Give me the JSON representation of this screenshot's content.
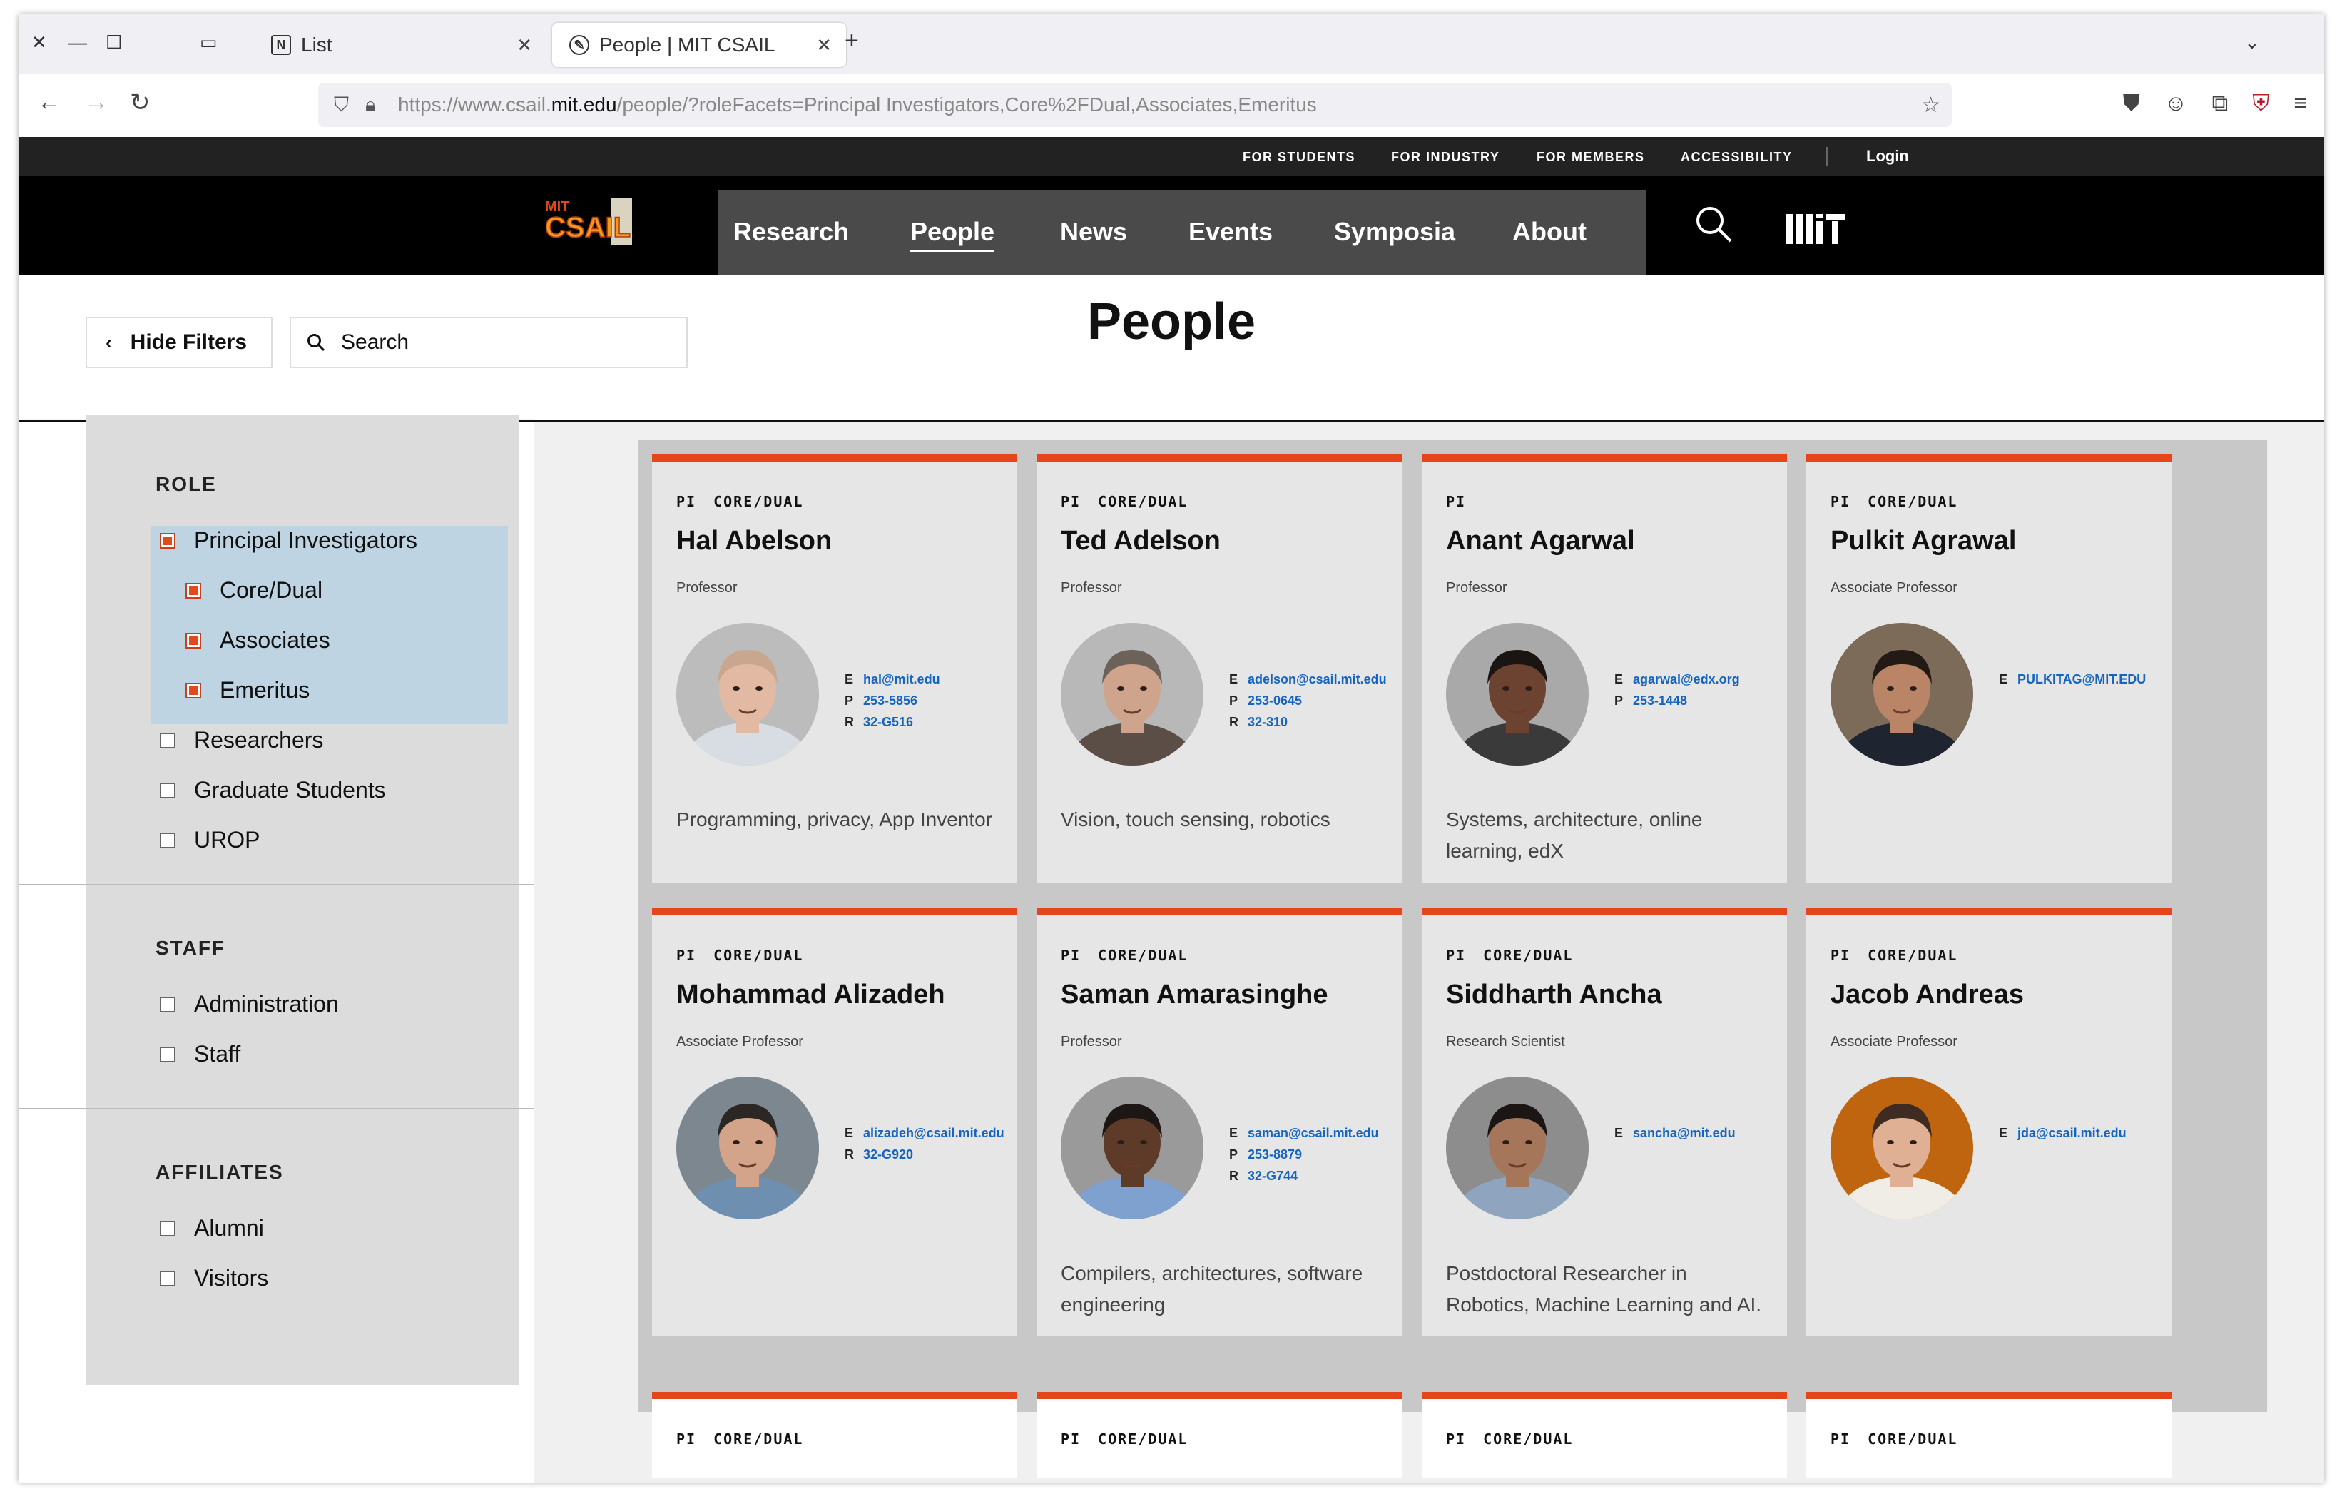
{
  "browser": {
    "tabs": [
      {
        "label": "List",
        "active": false
      },
      {
        "label": "People | MIT CSAIL",
        "active": true
      }
    ],
    "url_prefix": "https://www.csail.",
    "url_host": "mit.edu",
    "url_path": "/people/?roleFacets=Principal Investigators,Core%2FDual,Associates,Emeritus"
  },
  "utility_nav": [
    "FOR STUDENTS",
    "FOR INDUSTRY",
    "FOR MEMBERS",
    "ACCESSIBILITY"
  ],
  "login_label": "Login",
  "logo_text": {
    "top": "MIT",
    "bottom": "CSAIL"
  },
  "main_nav": [
    "Research",
    "People",
    "News",
    "Events",
    "Symposia",
    "About"
  ],
  "current_nav": "People",
  "page": {
    "title": "People",
    "hide_filters_label": "Hide Filters",
    "search_placeholder": "Search"
  },
  "filters": {
    "role": {
      "title": "ROLE",
      "items": [
        {
          "label": "Principal Investigators",
          "checked": true,
          "indent": false
        },
        {
          "label": "Core/Dual",
          "checked": true,
          "indent": true
        },
        {
          "label": "Associates",
          "checked": true,
          "indent": true
        },
        {
          "label": "Emeritus",
          "checked": true,
          "indent": true
        },
        {
          "label": "Researchers",
          "checked": false,
          "indent": false
        },
        {
          "label": "Graduate Students",
          "checked": false,
          "indent": false
        },
        {
          "label": "UROP",
          "checked": false,
          "indent": false
        }
      ]
    },
    "staff": {
      "title": "STAFF",
      "items": [
        {
          "label": "Administration",
          "checked": false
        },
        {
          "label": "Staff",
          "checked": false
        }
      ]
    },
    "affiliates": {
      "title": "AFFILIATES",
      "items": [
        {
          "label": "Alumni",
          "checked": false
        },
        {
          "label": "Visitors",
          "checked": false
        }
      ]
    }
  },
  "people": [
    {
      "tags": [
        "PI",
        "CORE/DUAL"
      ],
      "name": "Hal Abelson",
      "title": "Professor",
      "contact": [
        [
          "E",
          "hal@mit.edu"
        ],
        [
          "P",
          "253-5856"
        ],
        [
          "R",
          "32-G516"
        ]
      ],
      "desc": "Programming, privacy, App Inventor",
      "skin": "#e2b9a3",
      "hair": "#c9a78e",
      "shirt": "#d7dde3",
      "bg": "#bcbcbc"
    },
    {
      "tags": [
        "PI",
        "CORE/DUAL"
      ],
      "name": "Ted Adelson",
      "title": "Professor",
      "contact": [
        [
          "E",
          "adelson@csail.mit.edu"
        ],
        [
          "P",
          "253-0645"
        ],
        [
          "R",
          "32-310"
        ]
      ],
      "desc": "Vision, touch sensing, robotics",
      "skin": "#cfa48c",
      "hair": "#6c625a",
      "shirt": "#5a4e46",
      "bg": "#b8b8b8"
    },
    {
      "tags": [
        "PI"
      ],
      "name": "Anant Agarwal",
      "title": "Professor",
      "contact": [
        [
          "E",
          "agarwal@edx.org"
        ],
        [
          "P",
          "253-1448"
        ]
      ],
      "desc": "Systems, architecture, online learning, edX",
      "skin": "#6b4330",
      "hair": "#1a1412",
      "shirt": "#3a3a3a",
      "bg": "#a9a9a9"
    },
    {
      "tags": [
        "PI",
        "CORE/DUAL"
      ],
      "name": "Pulkit Agrawal",
      "title": "Associate Professor",
      "contact": [
        [
          "E",
          "PULKITAG@MIT.EDU"
        ]
      ],
      "desc": "",
      "skin": "#b98566",
      "hair": "#231a16",
      "shirt": "#1e2430",
      "bg": "#7b6b58"
    },
    {
      "tags": [
        "PI",
        "CORE/DUAL"
      ],
      "name": "Mohammad Alizadeh",
      "title": "Associate Professor",
      "contact": [
        [
          "E",
          "alizadeh@csail.mit.edu"
        ],
        [
          "R",
          "32-G920"
        ]
      ],
      "desc": "",
      "skin": "#d3a489",
      "hair": "#2c2624",
      "shirt": "#6f8fb0",
      "bg": "#7d8790"
    },
    {
      "tags": [
        "PI",
        "CORE/DUAL"
      ],
      "name": "Saman Amarasinghe",
      "title": "Professor",
      "contact": [
        [
          "E",
          "saman@csail.mit.edu"
        ],
        [
          "P",
          "253-8879"
        ],
        [
          "R",
          "32-G744"
        ]
      ],
      "desc": "Compilers, architectures, software engineering",
      "skin": "#5e3b28",
      "hair": "#1c1715",
      "shirt": "#7fa1d0",
      "bg": "#9a9a9a"
    },
    {
      "tags": [
        "PI",
        "CORE/DUAL"
      ],
      "name": "Siddharth Ancha",
      "title": "Research Scientist",
      "contact": [
        [
          "E",
          "sancha@mit.edu"
        ]
      ],
      "desc": "Postdoctoral Researcher in Robotics, Machine Learning and AI.",
      "skin": "#a6765a",
      "hair": "#1b1614",
      "shirt": "#8ea4bf",
      "bg": "#8d8d8d"
    },
    {
      "tags": [
        "PI",
        "CORE/DUAL"
      ],
      "name": "Jacob Andreas",
      "title": "Associate Professor",
      "contact": [
        [
          "E",
          "jda@csail.mit.edu"
        ]
      ],
      "desc": "",
      "skin": "#e0b094",
      "hair": "#3e2c22",
      "shirt": "#f0ece6",
      "bg": "#c0650f"
    }
  ],
  "next_row_tags": [
    [
      "PI",
      "CORE/DUAL"
    ],
    [
      "PI",
      "CORE/DUAL"
    ],
    [
      "PI",
      "CORE/DUAL"
    ],
    [
      "PI",
      "CORE/DUAL"
    ]
  ],
  "colors": {
    "accent": "#e5451b",
    "link": "#1565c0",
    "filter_highlight": "#bfd4e2"
  }
}
